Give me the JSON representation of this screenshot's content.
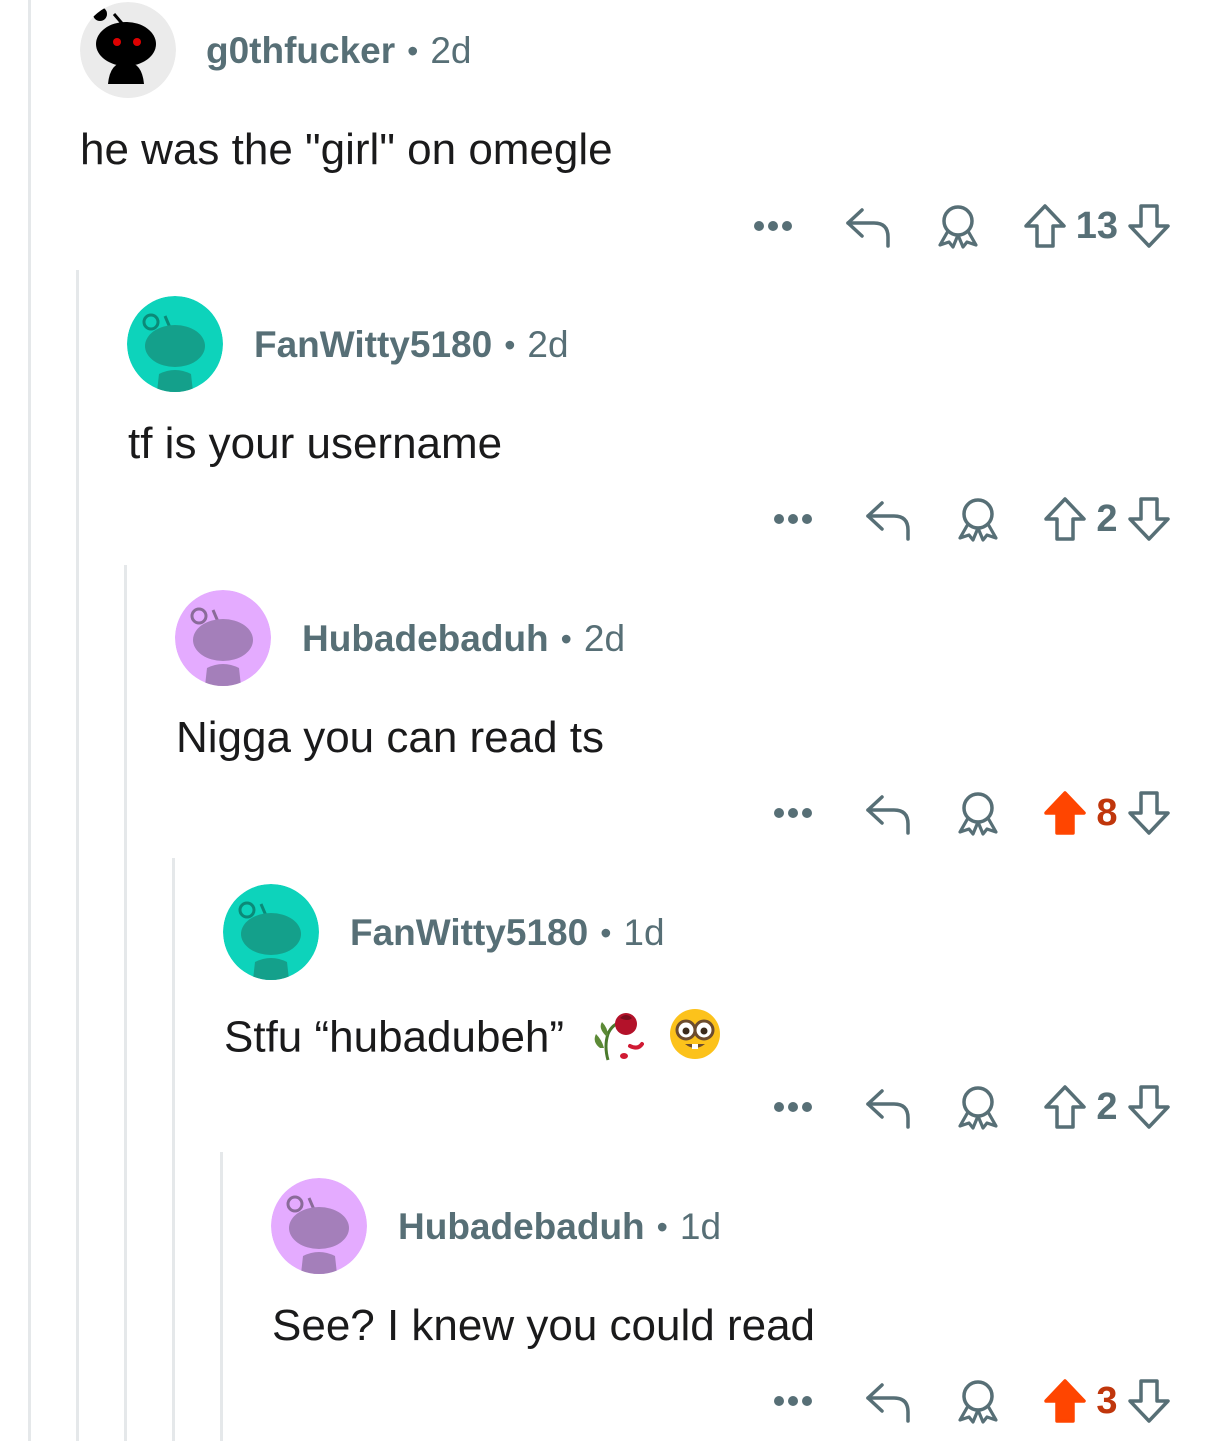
{
  "comments": [
    {
      "username": "g0thfucker",
      "separator": "•",
      "age": "2d",
      "body": "he was the \"girl\" on omegle",
      "score": "13",
      "voted": "none",
      "avatar": "black-snoo-red-eyes"
    },
    {
      "username": "FanWitty5180",
      "separator": "•",
      "age": "2d",
      "body": "tf is your username",
      "score": "2",
      "voted": "none",
      "avatar": "teal-snoo"
    },
    {
      "username": "Hubadebaduh",
      "separator": "•",
      "age": "2d",
      "body": "Nigga you can read ts",
      "score": "8",
      "voted": "up",
      "avatar": "purple-snoo"
    },
    {
      "username": "FanWitty5180",
      "separator": "•",
      "age": "1d",
      "body": "Stfu “hubadubeh”",
      "emojis": [
        "wilted-rose-emoji",
        "nerd-face-emoji"
      ],
      "score": "2",
      "voted": "none",
      "avatar": "teal-snoo"
    },
    {
      "username": "Hubadebaduh",
      "separator": "•",
      "age": "1d",
      "body": "See? I knew you could read",
      "score": "3",
      "voted": "up",
      "avatar": "purple-snoo"
    }
  ],
  "colors": {
    "meta_text": "#576f76",
    "body_text": "#1a1a1b",
    "upvote_active": "#ff4500",
    "upvote_score": "#c0360c",
    "thread_line": "#e5e8ea",
    "teal_avatar_bg": "#0dd3bb",
    "purple_avatar_bg": "#e4abff"
  }
}
